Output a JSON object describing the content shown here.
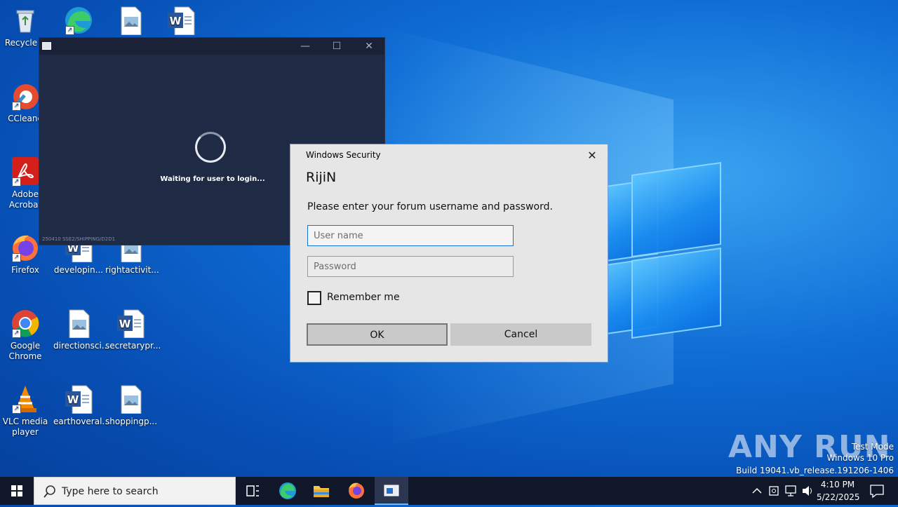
{
  "desktop": {
    "icons": [
      {
        "label": "Recycle B"
      },
      {
        "label": ""
      },
      {
        "label": ""
      },
      {
        "label": ""
      },
      {
        "label": "CCleane"
      },
      {
        "label": "Adobe Acrobat"
      },
      {
        "label": "Firefox"
      },
      {
        "label": "developin..."
      },
      {
        "label": "rightactivit..."
      },
      {
        "label": "Google Chrome"
      },
      {
        "label": "directionsci..."
      },
      {
        "label": "secretarypr..."
      },
      {
        "label": "VLC media player"
      },
      {
        "label": "earthoveral..."
      },
      {
        "label": "shoppingp..."
      }
    ]
  },
  "loader_window": {
    "minimize": "—",
    "maximize": "☐",
    "close": "✕",
    "status": "Waiting for user to login...",
    "build": "250410 SSE2/SHIPPING/D2D1"
  },
  "dialog": {
    "title": "Windows Security",
    "close": "✕",
    "heading": "RijiN",
    "message": "Please enter your forum username and password.",
    "username_placeholder": "User name",
    "password_placeholder": "Password",
    "remember_label": "Remember me",
    "ok_label": "OK",
    "cancel_label": "Cancel"
  },
  "watermark": {
    "brand": "ANY RUN",
    "line1": "Test Mode",
    "line2": "Windows 10 Pro",
    "line3": "Build 19041.vb_release.191206-1406"
  },
  "taskbar": {
    "search_placeholder": "Type here to search",
    "time": "4:10 PM",
    "date": "5/22/2025"
  },
  "colors": {
    "desktop_blue": "#0f6ed6",
    "taskbar": "#0f1729",
    "dialog_bg": "#e6e6e6",
    "focus_border": "#1a73d0"
  }
}
